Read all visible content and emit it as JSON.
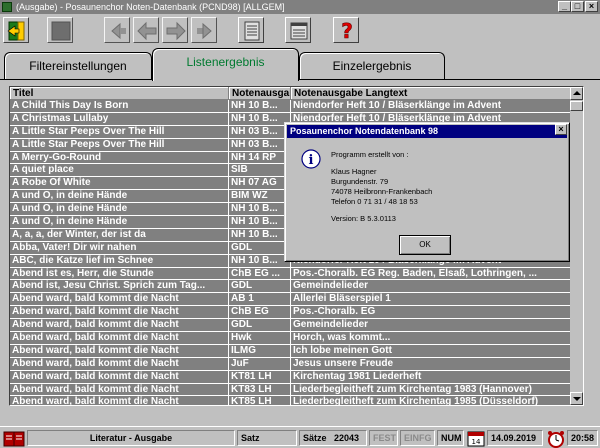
{
  "window": {
    "title": "(Ausgabe) - Posaunenchor Noten-Datenbank (PCND98) [ALLGEM]",
    "minimize": "_",
    "maximize": "□",
    "close": "×"
  },
  "toolbar": {
    "icons": [
      "exit-door-icon",
      "monitor-icon",
      "previous-icon",
      "back-arrow-icon",
      "forward-arrow-icon",
      "next-icon",
      "document-icon",
      "notes-icon",
      "help-icon"
    ]
  },
  "tabs": [
    {
      "label": "Filtereinstellungen",
      "active": false
    },
    {
      "label": "Listenergebnis",
      "active": true
    },
    {
      "label": "Einzelergebnis",
      "active": false
    }
  ],
  "table": {
    "columns": [
      "Titel",
      "Notenausgabe",
      "Notenausgabe Langtext"
    ],
    "rows": [
      [
        "A Child This Day Is Born",
        "NH 10 B...",
        "Niendorfer Heft 10 / Bläserklänge im Advent"
      ],
      [
        "A Christmas Lullaby",
        "NH 10 B...",
        "Niendorfer Heft 10 / Bläserklänge im Advent"
      ],
      [
        "A Little Star Peeps Over The Hill",
        "NH 03 B...",
        ""
      ],
      [
        "A Little Star Peeps Over The Hill",
        "NH 03 B...",
        ""
      ],
      [
        "A Merry-Go-Round",
        "NH 14 RP",
        ""
      ],
      [
        "A quiet place",
        "SIB",
        ""
      ],
      [
        "A Robe Of White",
        "NH 07 AG",
        ""
      ],
      [
        "A und O, in deine Hände",
        "BIM WZ",
        ""
      ],
      [
        "A und O, in deine Hände",
        "NH 10 B...",
        ""
      ],
      [
        "A und O, in deine Hände",
        "NH 10 B...",
        ""
      ],
      [
        "A, a, a, der Winter, der ist da",
        "NH 10 B...",
        ""
      ],
      [
        "Abba, Vater! Dir wir nahen",
        "GDL",
        ""
      ],
      [
        "ABC, die Katze lief im Schnee",
        "NH 10 B...",
        "Niendorfer Heft 10 / Bläserklänge im Advent"
      ],
      [
        "Abend ist es, Herr, die Stunde",
        "ChB EG ...",
        "Pos.-Choralb. EG Reg. Baden, Elsaß, Lothringen, ..."
      ],
      [
        "Abend ist, Jesu Christ. Sprich zum Tag...",
        "GDL",
        "Gemeindelieder"
      ],
      [
        "Abend ward, bald kommt die Nacht",
        "AB 1",
        "Allerlei Bläserspiel 1"
      ],
      [
        "Abend ward, bald kommt die Nacht",
        "ChB EG",
        "Pos.-Choralb. EG"
      ],
      [
        "Abend ward, bald kommt die Nacht",
        "GDL",
        "Gemeindelieder"
      ],
      [
        "Abend ward, bald kommt die Nacht",
        "Hwk",
        "Horch, was kommt..."
      ],
      [
        "Abend ward, bald kommt die Nacht",
        "ILMG",
        "Ich lobe meinen Gott"
      ],
      [
        "Abend ward, bald kommt die Nacht",
        "JuF",
        "Jesus unsere Freude"
      ],
      [
        "Abend ward, bald kommt die Nacht",
        "KT81 LH",
        "Kirchentag 1981 Liederheft"
      ],
      [
        "Abend ward, bald kommt die Nacht",
        "KT83 LH",
        "Liederbegleitheft zum Kirchentag 1983 (Hannover)"
      ],
      [
        "Abend ward, bald kommt die Nacht",
        "KT85 LH",
        "Liederbegleitheft zum Kirchentag 1985 (Düsseldorf)"
      ]
    ]
  },
  "dialog": {
    "title": "Posaunenchor Notendatenbank 98",
    "close": "×",
    "line_created": "Programm erstellt von :",
    "name": "Klaus Hagner",
    "street": "Burgundenstr. 79",
    "city": "74078 Heilbronn-Frankenbach",
    "phone": "Telefon 0 71 31 / 48 18 53",
    "version": "Version:   B 5.3.0113",
    "ok": "OK"
  },
  "status": {
    "module": "Literatur - Ausgabe",
    "mode": "Satz",
    "records_label": "Sätze",
    "records": "22043",
    "fest": "FEST",
    "einfg": "EINFG",
    "num": "NUM",
    "date": "14.09.2019",
    "time": "20:58"
  }
}
